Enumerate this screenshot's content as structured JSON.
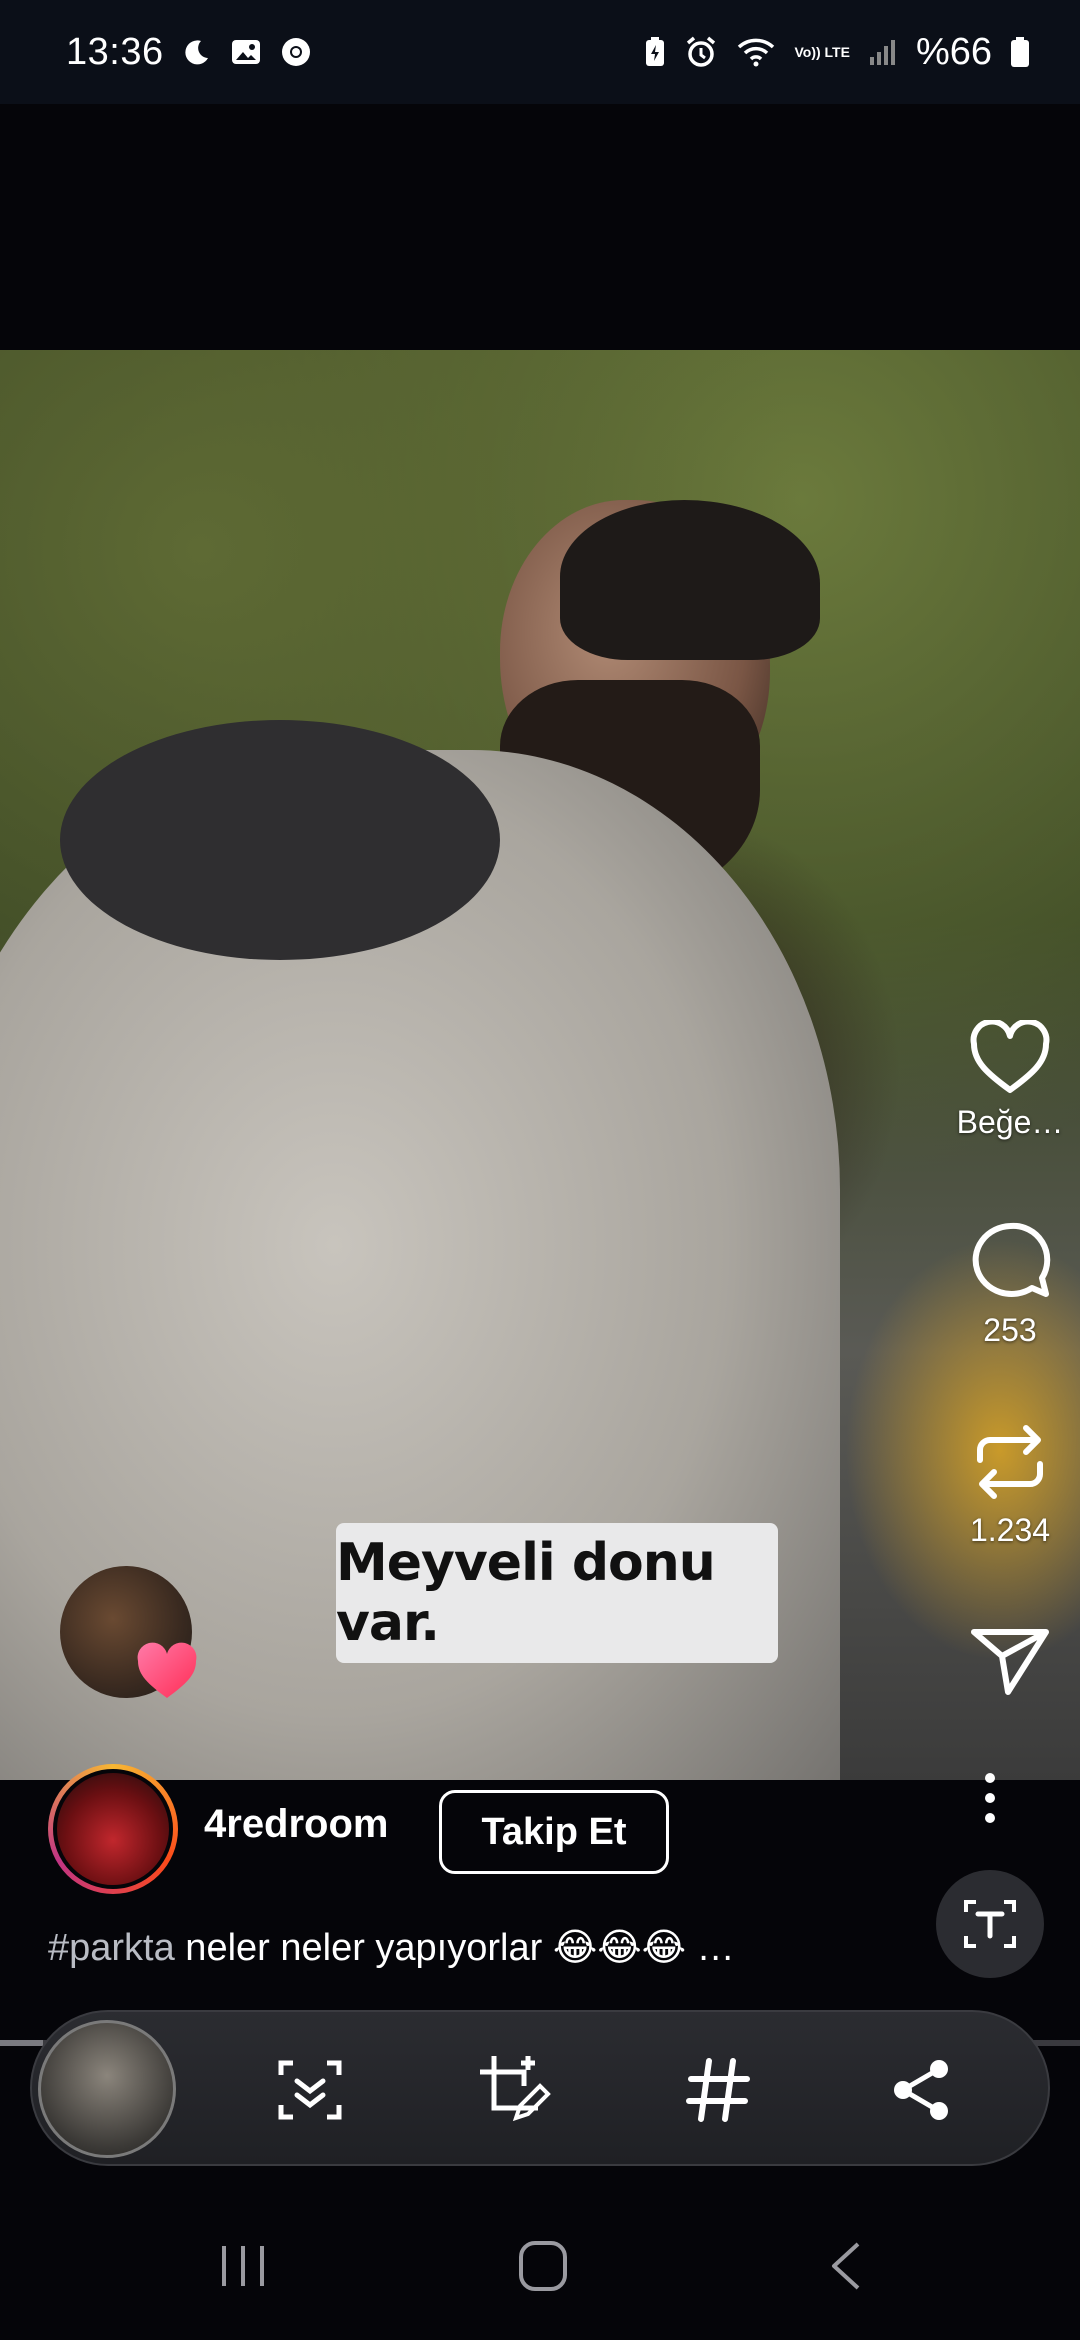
{
  "status_bar": {
    "time": "13:36",
    "left_icons": [
      "moon-icon",
      "image-icon",
      "chrome-icon"
    ],
    "right_icons": [
      "battery-saver-icon",
      "alarm-icon",
      "wifi-icon",
      "volte-icon",
      "signal-icon",
      "battery-icon"
    ],
    "volte_label": "Vo)) LTE",
    "battery": "%66"
  },
  "video": {
    "caption": "Meyveli donu var."
  },
  "actions": {
    "like_label": "Beğe…",
    "comments_count": "253",
    "reposts_count": "1.234"
  },
  "author": {
    "name": "4redroom",
    "follow_label": "Takip Et"
  },
  "description": {
    "hashtag": "#parkta",
    "text": " neler neler yapıyorlar 😂😂😂 …"
  },
  "toolbar": {
    "icons": [
      "scan-icon",
      "edit-image-icon",
      "hashtag-icon",
      "share-icon"
    ]
  },
  "navbar": {
    "icons": [
      "recent-apps-icon",
      "home-icon",
      "back-icon"
    ]
  }
}
